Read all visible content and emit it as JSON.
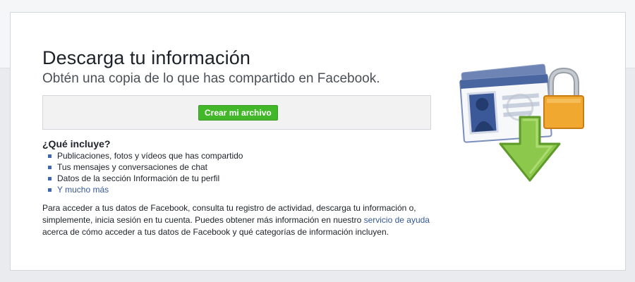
{
  "header": {
    "title": "Descarga tu información",
    "subtitle": "Obtén una copia de lo que has compartido en Facebook."
  },
  "action": {
    "create_button_label": "Crear mi archivo"
  },
  "includes": {
    "heading": "¿Qué incluye?",
    "items": [
      "Publicaciones, fotos y vídeos que has compartido",
      "Tus mensajes y conversaciones de chat",
      "Datos de la sección Información de tu perfil"
    ],
    "more_link": "Y mucho más"
  },
  "info": {
    "text_before_link": "Para acceder a tus datos de Facebook, consulta tu registro de actividad, descarga tu información o, simplemente, inicia sesión en tu cuenta. Puedes obtener más información en nuestro ",
    "help_link": "servicio de ayuda",
    "text_after_link": " acerca de cómo acceder a tus datos de Facebook y qué categorías de información incluyen."
  },
  "colors": {
    "button_green": "#42b72a",
    "link_blue": "#365899",
    "bullet_blue": "#4267b2",
    "arrow_green": "#8cc84b",
    "lock_orange": "#f0a830"
  },
  "icons": {
    "illustration": "id-card-lock-download-icon"
  }
}
